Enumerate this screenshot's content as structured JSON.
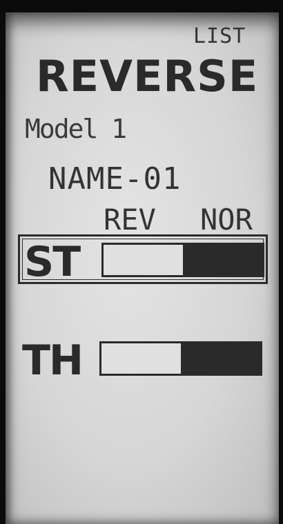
{
  "header": {
    "menu_label": "LIST",
    "title": "REVERSE"
  },
  "model": {
    "label": "Model 1",
    "name": "NAME-01"
  },
  "columns": {
    "reverse_label": "REV",
    "normal_label": "NOR"
  },
  "channels": [
    {
      "label": "ST",
      "setting": "NOR",
      "selected": true,
      "fill_fraction": 0.5
    },
    {
      "label": "TH",
      "setting": "NOR",
      "selected": false,
      "fill_fraction": 0.5
    }
  ],
  "colors": {
    "lcd_background": "#d8d8d8",
    "lcd_ink": "#2a2a2a",
    "bezel": "#0b0b0b"
  }
}
